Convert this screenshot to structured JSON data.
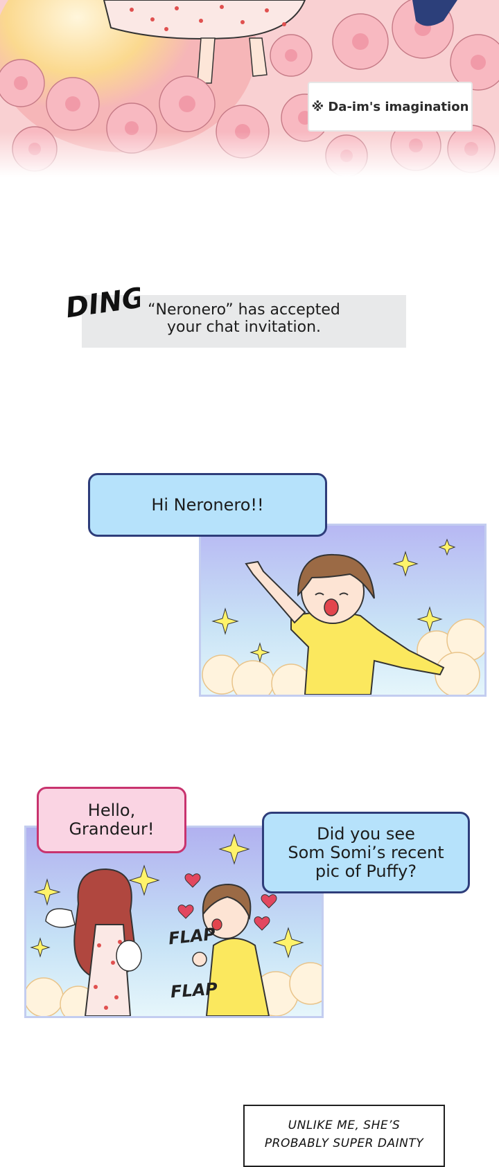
{
  "top_panel": {
    "note": "※ Da-im's imagination"
  },
  "notification": {
    "sfx": "DING",
    "line1": "“Neronero” has accepted",
    "line2": "your chat invitation."
  },
  "panel1": {
    "bubble": "Hi Neronero!!"
  },
  "panel2": {
    "bubble_left_line1": "Hello,",
    "bubble_left_line2": "Grandeur!",
    "bubble_right_line1": "Did you see",
    "bubble_right_line2": "Som Somi’s recent",
    "bubble_right_line3": "pic of Puffy?",
    "sfx_1": "FLAP",
    "sfx_2": "FLAP"
  },
  "caption": {
    "line1": "UNLIKE ME, SHE’S",
    "line2": "PROBABLY SUPER DAINTY"
  },
  "colors": {
    "blue_bubble": "#b6e2fb",
    "pink_bubble": "#fad4e3",
    "notice_bar": "#e8e9ea",
    "panel_border": "#c3cdf0"
  }
}
